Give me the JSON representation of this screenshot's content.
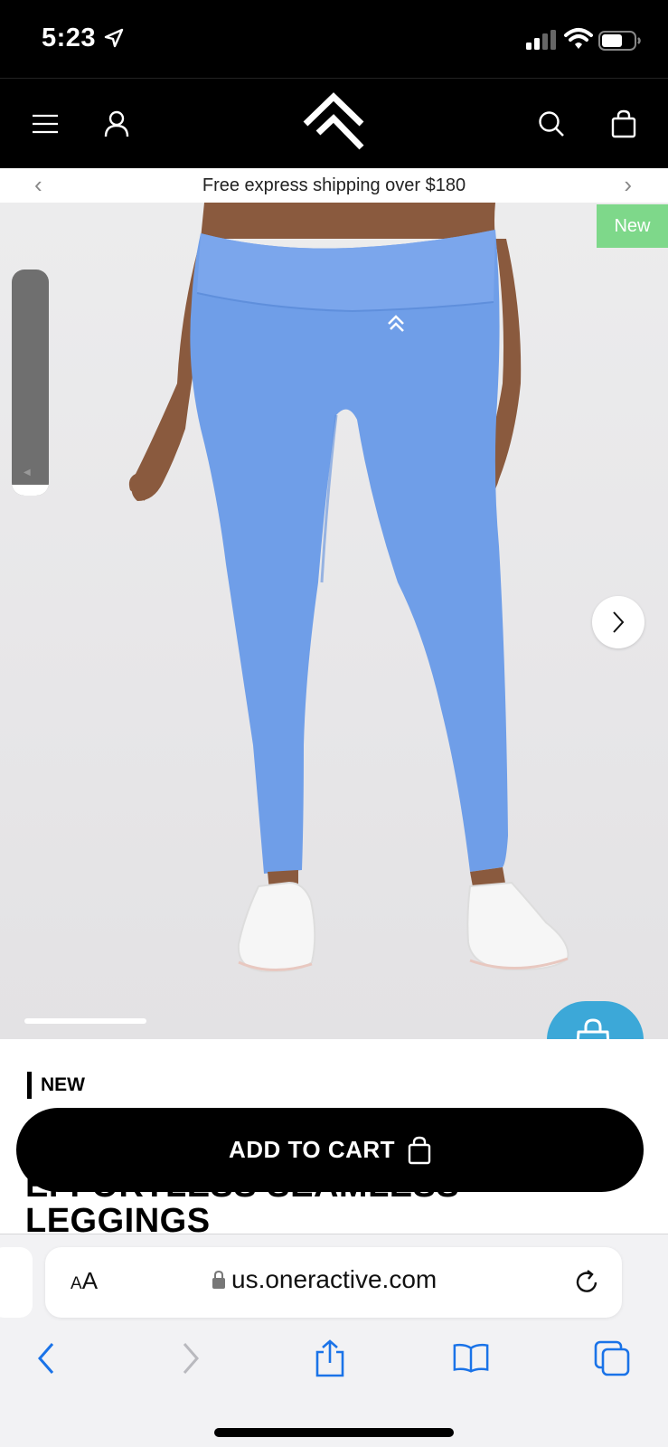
{
  "status_bar": {
    "time": "5:23",
    "icons": [
      "location-arrow-icon",
      "cellular-signal-icon",
      "wifi-icon",
      "battery-icon"
    ]
  },
  "header": {
    "icons": [
      "menu-icon",
      "account-icon",
      "brand-logo-icon",
      "search-icon",
      "shopping-bag-icon"
    ]
  },
  "promo": {
    "text": "Free express shipping over $180",
    "prev": "‹",
    "next": "›"
  },
  "product_image": {
    "badge": "New",
    "accent_color": "#7ed88a",
    "legging_color": "#6f9ee8"
  },
  "product": {
    "label": "NEW",
    "title_line_1": "EFFORTLESS SEAMLESS",
    "title_line_2": "LEGGINGS"
  },
  "cart": {
    "add_label": "ADD TO CART"
  },
  "wishlist": {
    "color": "#3ca8d8"
  },
  "browser": {
    "aa_small": "A",
    "aa_large": "A",
    "url": "us.oneractive.com",
    "toolbar_icons": [
      "back-icon",
      "forward-icon",
      "share-icon",
      "bookmarks-icon",
      "tabs-icon"
    ],
    "tint": "#1a73e8"
  }
}
